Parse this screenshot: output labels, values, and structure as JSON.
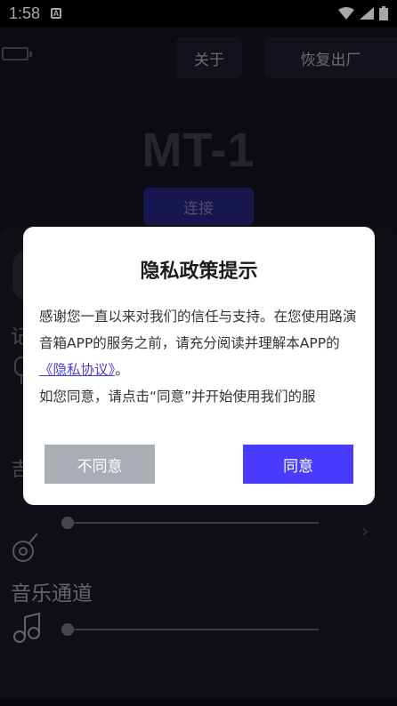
{
  "status_bar": {
    "time": "1:58",
    "notification_icon": "A"
  },
  "header": {
    "about_label": "关于",
    "factory_reset_label": "恢复出厂"
  },
  "device": {
    "name": "MT-1",
    "connect_label": "连接"
  },
  "background_panel": {
    "label_1_partial": "记",
    "label_2_partial": "吉",
    "section_title": "音乐通道"
  },
  "privacy_dialog": {
    "title": "隐私政策提示",
    "body_line_1": "感谢您一直以来对我们的信任与支持。在您使用路演音箱APP的服务之前，请充分阅读并理解本APP的",
    "link_text": "《隐私协议》",
    "body_after_link": "。",
    "body_line_2": "如您同意，请点击“同意”并开始使用我们的服",
    "disagree_label": "不同意",
    "agree_label": "同意"
  },
  "colors": {
    "accent": "#4a3cff",
    "disagree_bg": "#a9adb4",
    "link": "#4a3ee0"
  }
}
